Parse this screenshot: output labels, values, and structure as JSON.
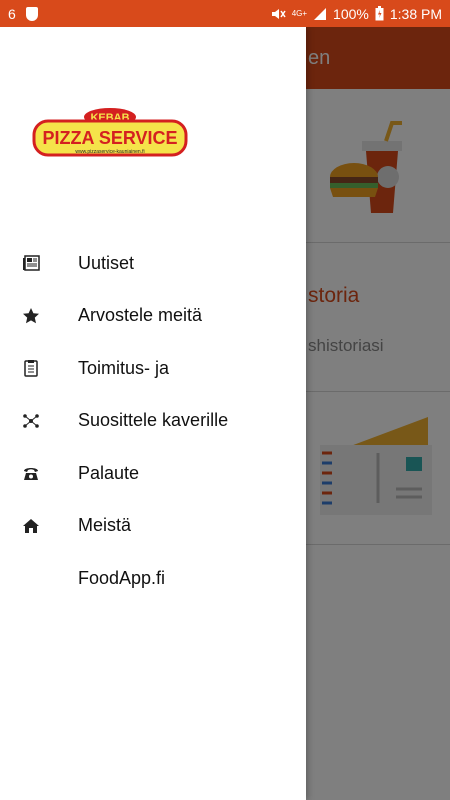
{
  "status_bar": {
    "notification_count": "6",
    "network_label": "4G+",
    "battery": "100%",
    "time": "1:38 PM"
  },
  "background_app": {
    "appbar_title": "en",
    "card2_heading": "storia",
    "card2_subtitle": "shistoriasi"
  },
  "drawer": {
    "logo": {
      "top_text": "KEBAB",
      "main_text": "PIZZA SERVICE",
      "url": "www.pizzaservice-kauniainen.fi"
    },
    "items": [
      {
        "label": "Uutiset",
        "icon": "newspaper-icon"
      },
      {
        "label": "Arvostele meitä",
        "icon": "star-icon"
      },
      {
        "label": "Toimitus- ja",
        "icon": "clipboard-icon"
      },
      {
        "label": "Suosittele kaverille",
        "icon": "share-icon"
      },
      {
        "label": "Palaute",
        "icon": "phone-icon"
      },
      {
        "label": "Meistä",
        "icon": "home-icon"
      },
      {
        "label": "FoodApp.fi",
        "icon": ""
      }
    ]
  },
  "colors": {
    "brand": "#d84a1b",
    "logo_yellow": "#f5e34a",
    "logo_red": "#d42020"
  }
}
